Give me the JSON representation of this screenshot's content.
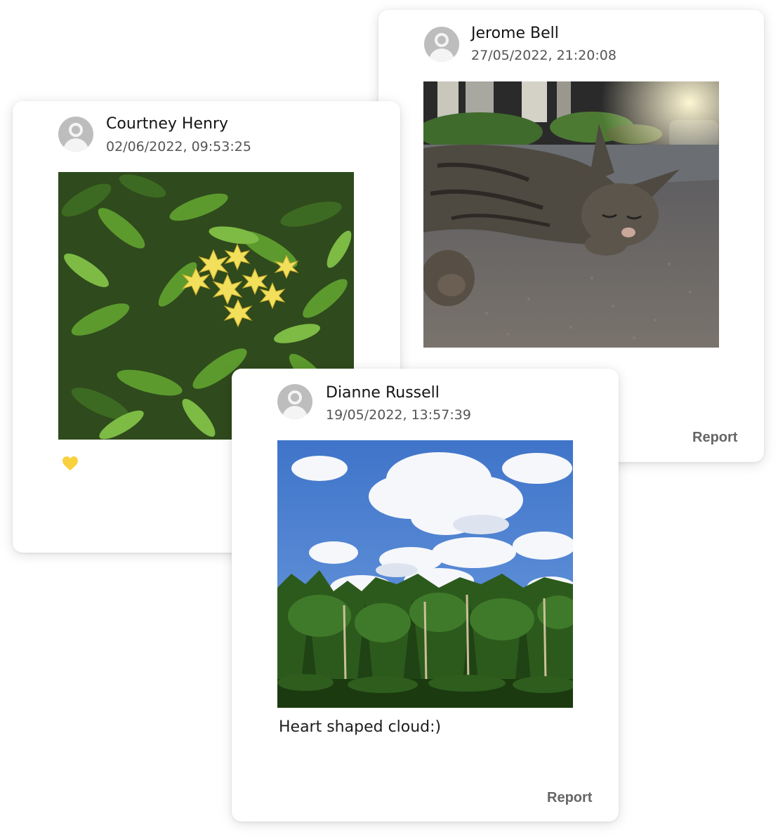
{
  "posts": [
    {
      "author": "Jerome Bell",
      "timestamp": "27/05/2022, 21:20:08",
      "photo_icon": "photo-sleeping-cat",
      "caption": "",
      "report_label": "Report"
    },
    {
      "author": "Courtney Henry",
      "timestamp": "02/06/2022, 09:53:25",
      "photo_icon": "photo-yellow-flowers",
      "caption": "",
      "liked": true,
      "like_icon": "heart-icon",
      "like_color": "#f9d13e"
    },
    {
      "author": "Dianne Russell",
      "timestamp": "19/05/2022, 13:57:39",
      "photo_icon": "photo-heart-cloud-trees",
      "caption": "Heart shaped cloud:)",
      "report_label": "Report"
    }
  ],
  "avatar_icon": "user-avatar-icon",
  "colors": {
    "avatar": "#bdbdbd",
    "report_text": "#666666",
    "like": "#f9d13e"
  }
}
